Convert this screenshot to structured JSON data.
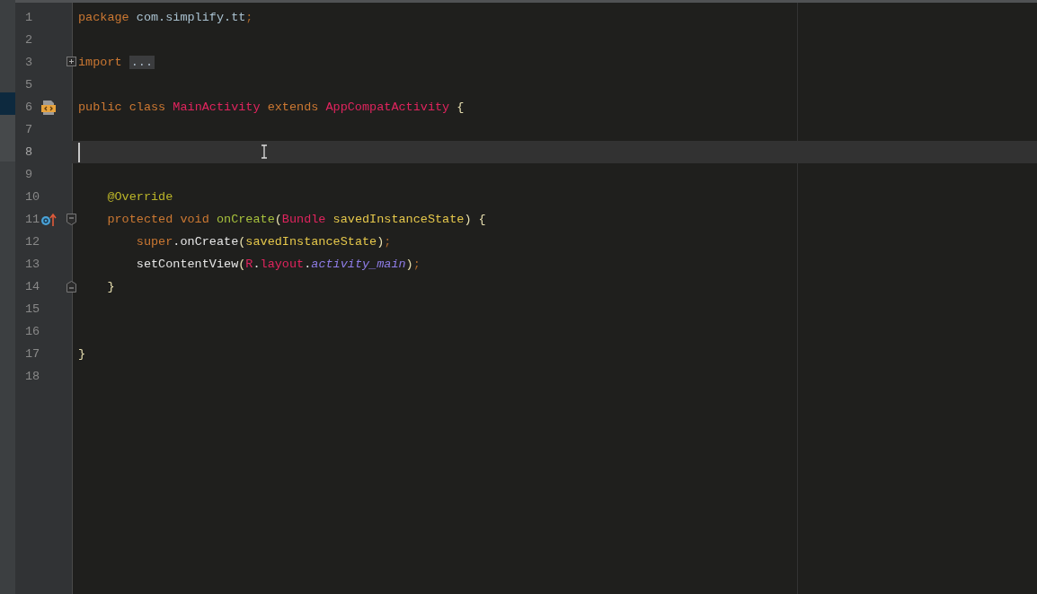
{
  "editor": {
    "lines": [
      {
        "number": "1",
        "current": false,
        "tokens": [
          {
            "text": "package ",
            "kind": "kw"
          },
          {
            "text": "com.simplify.tt",
            "kind": "pkg"
          },
          {
            "text": ";",
            "kind": "punct"
          }
        ]
      },
      {
        "number": "2",
        "current": false
      },
      {
        "number": "3",
        "current": false,
        "fold": {
          "kind": "collapsed"
        },
        "tokens": [
          {
            "text": "import ",
            "kind": "kw"
          },
          {
            "text": "...",
            "kind": "folded"
          }
        ]
      },
      {
        "number": "5",
        "current": false
      },
      {
        "number": "6",
        "current": false,
        "gutter_icon": {
          "kind": "class"
        },
        "tokens": [
          {
            "text": "public class ",
            "kind": "kw"
          },
          {
            "text": "MainActivity",
            "kind": "cls"
          },
          {
            "text": " extends ",
            "kind": "kw"
          },
          {
            "text": "AppCompatActivity",
            "kind": "cls"
          },
          {
            "text": " {",
            "kind": "brace"
          }
        ]
      },
      {
        "number": "7",
        "current": false
      },
      {
        "number": "8",
        "current": true
      },
      {
        "number": "9",
        "current": false
      },
      {
        "number": "10",
        "current": false,
        "tokens": [
          {
            "text": "    @Override",
            "kind": "ann"
          }
        ]
      },
      {
        "number": "11",
        "current": false,
        "gutter_icon": {
          "kind": "override"
        },
        "fold": {
          "kind": "start"
        },
        "tokens": [
          {
            "text": "    protected void ",
            "kind": "kw"
          },
          {
            "text": "onCreate",
            "kind": "method"
          },
          {
            "text": "(",
            "kind": "brace"
          },
          {
            "text": "Bundle ",
            "kind": "cls"
          },
          {
            "text": "savedInstanceState",
            "kind": "param"
          },
          {
            "text": ") {",
            "kind": "brace"
          }
        ]
      },
      {
        "number": "12",
        "current": false,
        "tokens": [
          {
            "text": "        super",
            "kind": "kw"
          },
          {
            "text": ".",
            "kind": "plain"
          },
          {
            "text": "onCreate",
            "kind": "plain"
          },
          {
            "text": "(",
            "kind": "brace"
          },
          {
            "text": "savedInstanceState",
            "kind": "param"
          },
          {
            "text": ")",
            "kind": "brace"
          },
          {
            "text": ";",
            "kind": "punct"
          }
        ]
      },
      {
        "number": "13",
        "current": false,
        "tokens": [
          {
            "text": "        setContentView",
            "kind": "plain"
          },
          {
            "text": "(",
            "kind": "brace"
          },
          {
            "text": "R",
            "kind": "cls"
          },
          {
            "text": ".",
            "kind": "plain"
          },
          {
            "text": "layout",
            "kind": "cls"
          },
          {
            "text": ".",
            "kind": "plain"
          },
          {
            "text": "activity_main",
            "kind": "field"
          },
          {
            "text": ")",
            "kind": "brace"
          },
          {
            "text": ";",
            "kind": "punct"
          }
        ]
      },
      {
        "number": "14",
        "current": false,
        "fold": {
          "kind": "end"
        },
        "tokens": [
          {
            "text": "    }",
            "kind": "brace"
          }
        ]
      },
      {
        "number": "15",
        "current": false
      },
      {
        "number": "16",
        "current": false
      },
      {
        "number": "17",
        "current": false,
        "tokens": [
          {
            "text": "}",
            "kind": "brace"
          }
        ]
      },
      {
        "number": "18",
        "current": false
      }
    ]
  }
}
